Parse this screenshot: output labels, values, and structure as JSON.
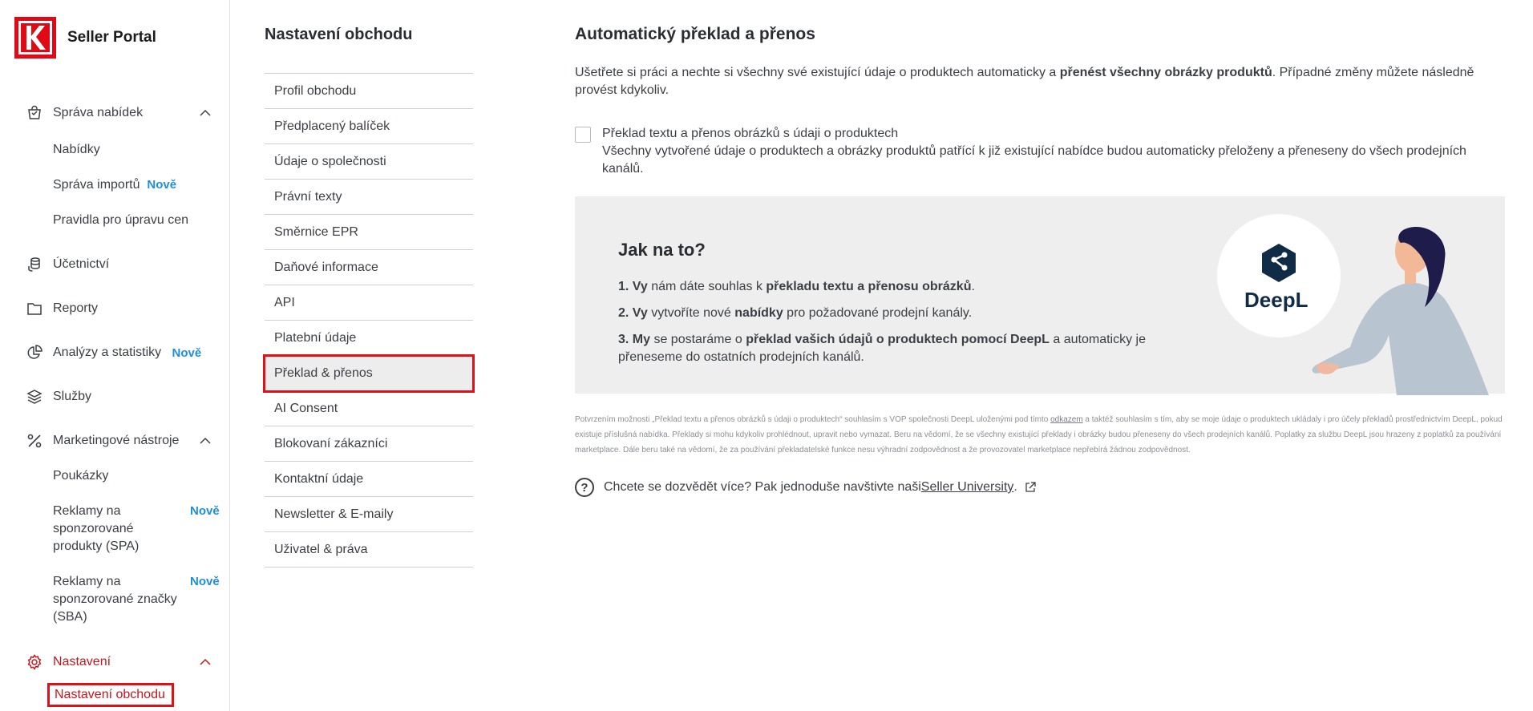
{
  "app": {
    "brand": "Seller Portal"
  },
  "sidebar": {
    "groups": [
      {
        "label": "Správa nabídek",
        "icon": "shopping-bag-icon",
        "expanded": true,
        "items": [
          {
            "label": "Nabídky",
            "badge": ""
          },
          {
            "label": "Správa importů",
            "badge": "Nově"
          },
          {
            "label": "Pravidla pro úpravu cen",
            "badge": ""
          }
        ]
      },
      {
        "label": "Účetnictví",
        "icon": "coins-icon"
      },
      {
        "label": "Reporty",
        "icon": "folder-icon"
      },
      {
        "label": "Analýzy a statistiky",
        "icon": "pie-chart-icon",
        "badge": "Nově"
      },
      {
        "label": "Služby",
        "icon": "layers-icon"
      },
      {
        "label": "Marketingové nástroje",
        "icon": "percent-icon",
        "expanded": true,
        "items": [
          {
            "label": "Poukázky",
            "badge": ""
          },
          {
            "label": "Reklamy na sponzorované produkty (SPA)",
            "label_lines": [
              "Reklamy na",
              "sponzorované",
              "produkty (SPA)"
            ],
            "badge": "Nově"
          },
          {
            "label": "Reklamy na sponzorované značky (SBA)",
            "label_lines": [
              "Reklamy na",
              "sponzorované značky",
              "(SBA)"
            ],
            "badge": "Nově"
          }
        ]
      },
      {
        "label": "Nastavení",
        "icon": "gear-icon",
        "expanded": true,
        "active": true,
        "items": [
          {
            "label": "Nastavení obchodu",
            "active": true
          }
        ]
      }
    ]
  },
  "settings_menu": {
    "title": "Nastavení obchodu",
    "items": [
      "Profil obchodu",
      "Předplacený balíček",
      "Údaje o společnosti",
      "Právní texty",
      "Směrnice EPR",
      "Daňové informace",
      "API",
      "Platební údaje",
      "Překlad & přenos",
      "AI Consent",
      "Blokovaní zákazníci",
      "Kontaktní údaje",
      "Newsletter & E-maily",
      "Uživatel & práva"
    ],
    "active_index": 8
  },
  "main": {
    "title": "Automatický překlad a přenos",
    "intro_a": "Ušetřete si práci a nechte si všechny své existující údaje o produktech automaticky a ",
    "intro_b": "přenést všechny obrázky produktů",
    "intro_c": ". Případné změny můžete následně provést kdykoliv.",
    "checkbox": {
      "checked": false,
      "label": "Překlad textu a přenos obrázků s údaji o produktech",
      "description": "Všechny vytvořené údaje o produktech a obrázky produktů patřící k již existující nabídce budou automaticky přeloženy a přeneseny do všech prodejních kanálů."
    },
    "howto": {
      "title": "Jak na to?",
      "step1_a": "1. Vy",
      "step1_b": " nám dáte souhlas k ",
      "step1_c": "překladu textu a přenosu obrázků",
      "step1_d": ".",
      "step2_a": "2. Vy",
      "step2_b": " vytvoříte nové ",
      "step2_c": "nabídky",
      "step2_d": " pro požadované prodejní kanály.",
      "step3_a": "3. My",
      "step3_b": " se postaráme o ",
      "step3_c": "překlad vašich údajů o produktech pomocí DeepL",
      "step3_d": " a automaticky je přeneseme do ostatních prodejních kanálů.",
      "logo_text": "DeepL"
    },
    "legal_a": "Potvrzením možnosti „Překlad textu a přenos obrázků s údaji o produktech“ souhlasím s VOP společnosti DeepL uloženými pod tímto ",
    "legal_link": "odkazem",
    "legal_b": " a taktéž souhlasím s tím, aby se moje údaje o produktech ukládaly i pro účely překladů prostřednictvím DeepL, pokud existuje příslušná nabídka. Překlady si mohu kdykoliv prohlédnout, upravit nebo vymazat. Beru na vědomí, že se všechny existující překlady i obrázky budou přeneseny do všech prodejních kanálů. Poplatky za službu DeepL jsou hrazeny z poplatků za používání marketplace. Dále beru také na vědomí, že za používání překladatelské funkce nesu výhradní zodpovědnost a že provozovatel marketplace nepřebírá žádnou zodpovědnost.",
    "more_text": "Chcete se dozvědět více? Pak jednoduše navštivte naši ",
    "more_link": "Seller University",
    "more_end": ".",
    "q_icon": "?"
  },
  "colors": {
    "brand_red": "#e10915",
    "link_blue": "#1d8fdb",
    "highlight_red": "#e01018"
  }
}
